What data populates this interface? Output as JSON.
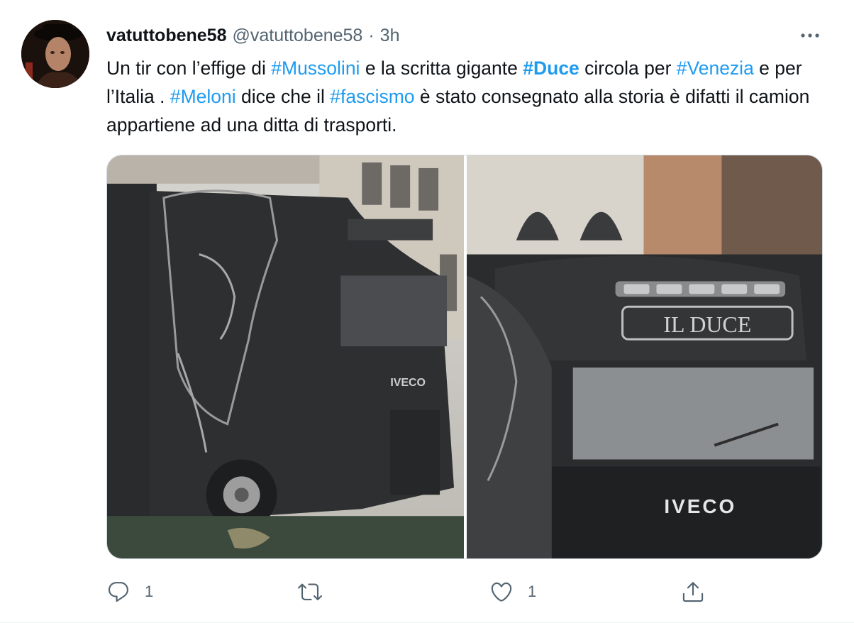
{
  "author": {
    "name": "vatuttobene58",
    "handle": "@vatuttobene58",
    "separator": "·",
    "time": "3h"
  },
  "tweet": {
    "segments": [
      {
        "text": "Un tir con l’effige di ",
        "type": "text"
      },
      {
        "text": "#Mussolini",
        "type": "hashtag"
      },
      {
        "text": " e la scritta gigante ",
        "type": "text"
      },
      {
        "text": "#Duce",
        "type": "hashtag-bold"
      },
      {
        "text": " circola per ",
        "type": "text"
      },
      {
        "text": "#Venezia",
        "type": "hashtag"
      },
      {
        "text": " e per l’Italia . ",
        "type": "text"
      },
      {
        "text": "#Meloni",
        "type": "hashtag"
      },
      {
        "text": " dice che il ",
        "type": "text"
      },
      {
        "text": "#fascismo",
        "type": "hashtag"
      },
      {
        "text": " è stato consegnato alla storia è difatti il camion appartiene ad una ditta di trasporti.",
        "type": "text"
      }
    ]
  },
  "media": {
    "left_photo": {
      "grille_text": "IVECO"
    },
    "right_photo": {
      "sign_text": "IL DUCE",
      "grille_text": "IVECO"
    }
  },
  "actions": {
    "reply_count": "1",
    "retweet_count": "",
    "like_count": "1"
  },
  "colors": {
    "link": "#1d9bf0",
    "secondary": "#536471",
    "text": "#0f1419"
  },
  "icons": {
    "more": "more-horizontal-icon",
    "reply": "reply-icon",
    "retweet": "retweet-icon",
    "like": "heart-icon",
    "share": "share-icon"
  }
}
